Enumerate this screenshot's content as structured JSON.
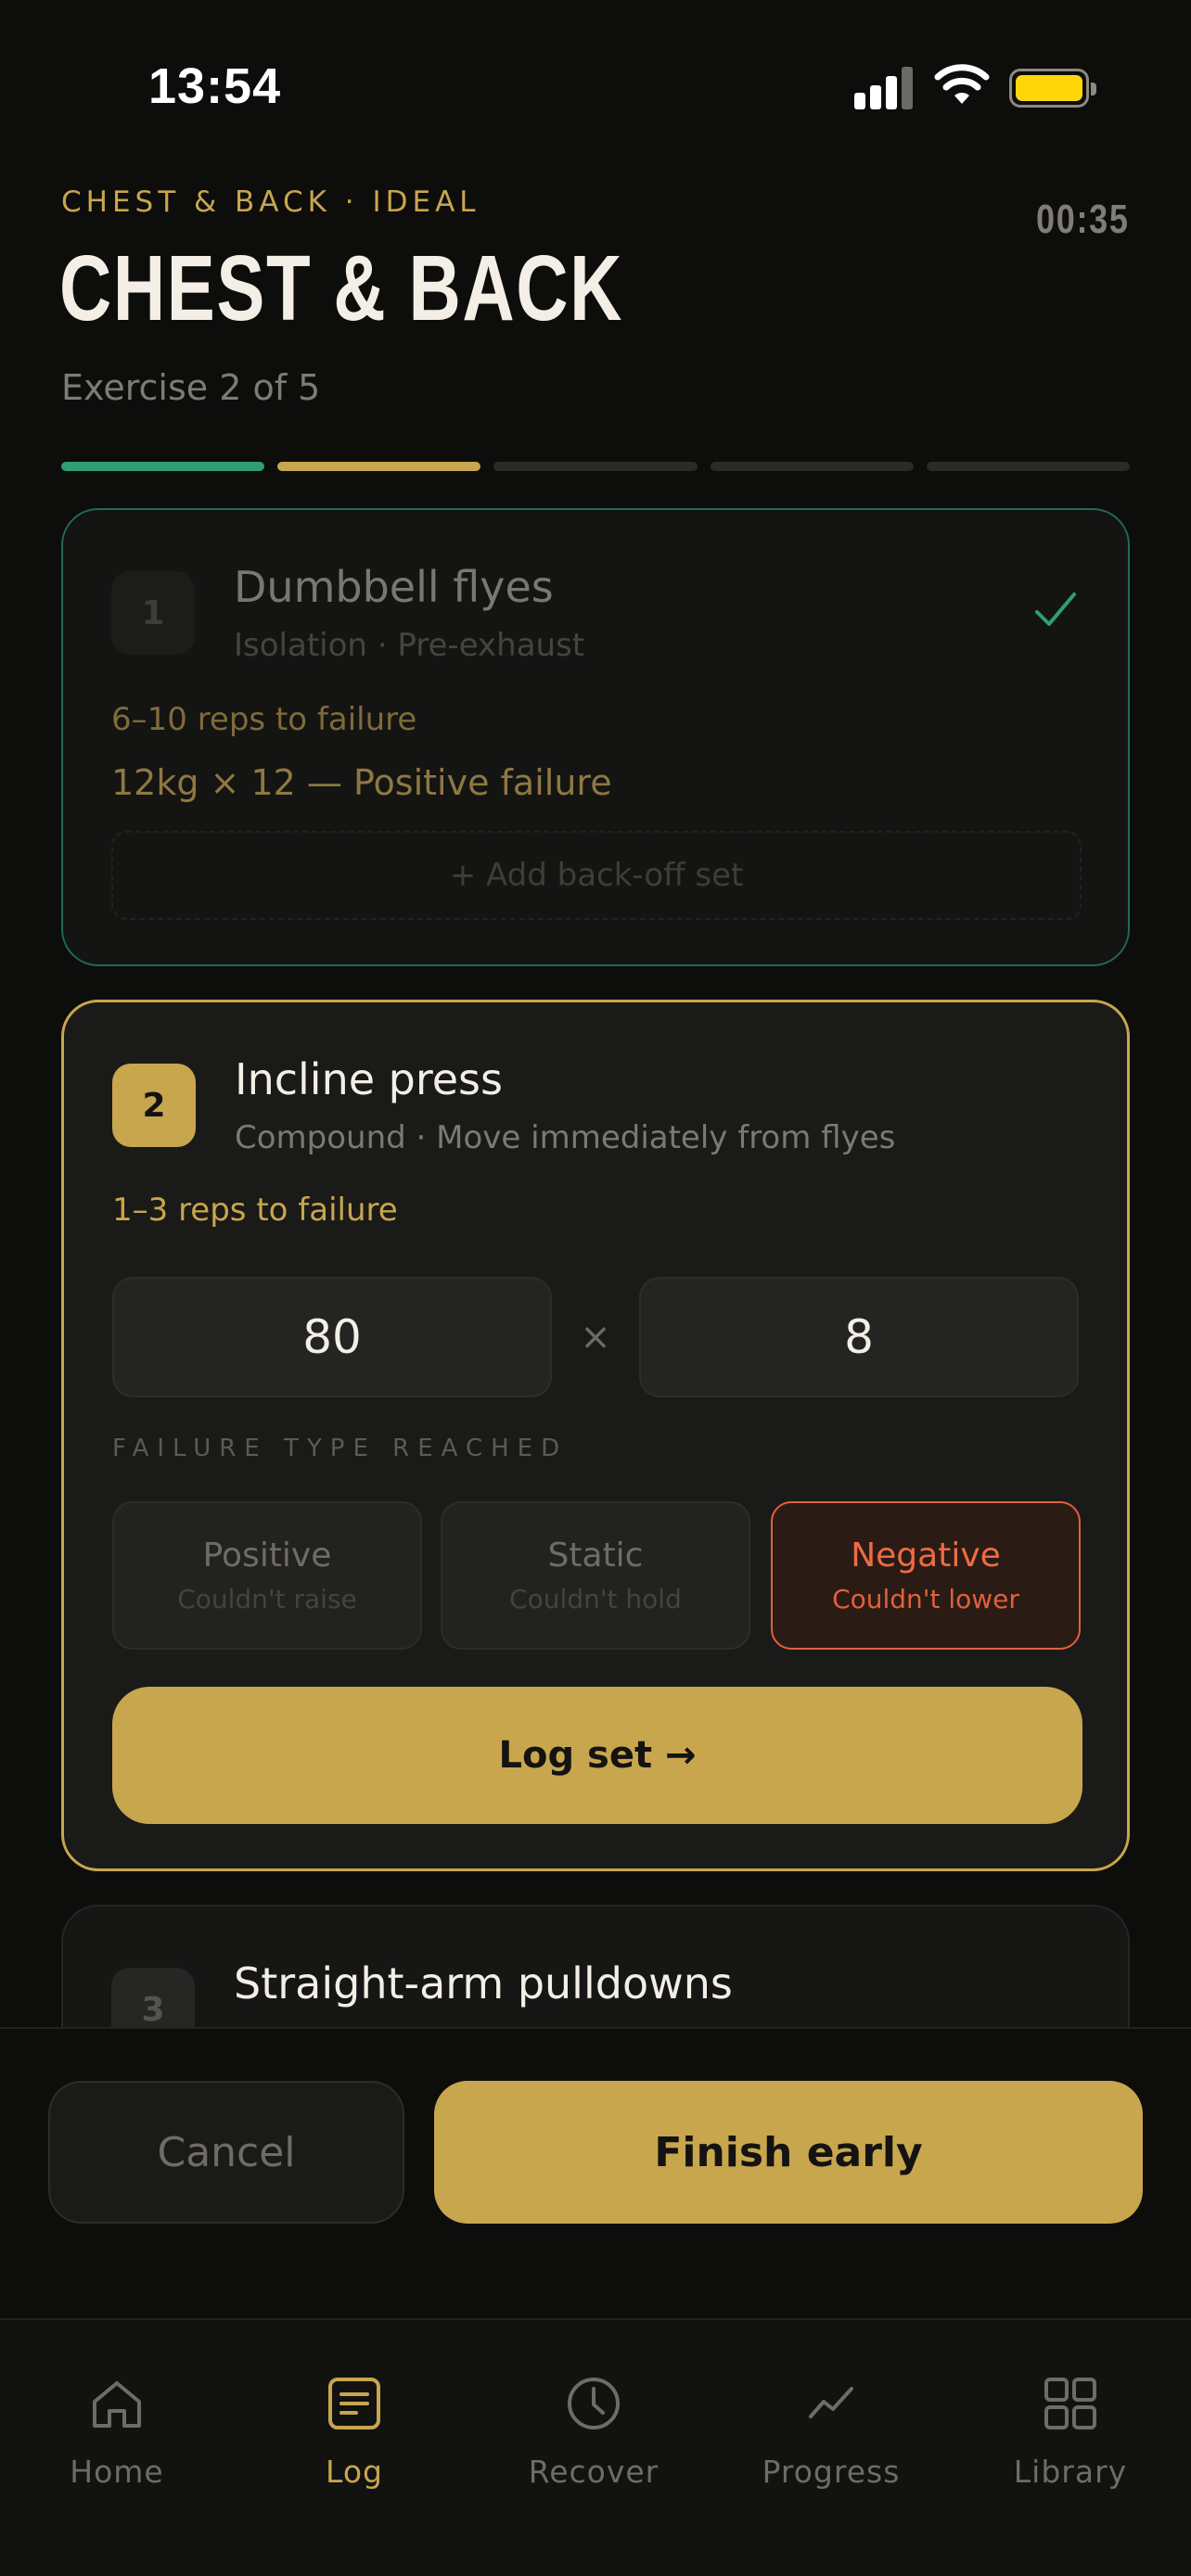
{
  "status_bar": {
    "time": "13:54",
    "battery_color": "#ffd60a"
  },
  "header": {
    "eyebrow": "CHEST & BACK · IDEAL",
    "timer": "00:35",
    "title": "CHEST & BACK",
    "subtitle": "Exercise 2 of 5",
    "progress": {
      "total_segments": 5,
      "completed": 1,
      "active": 2
    }
  },
  "exercises": [
    {
      "number": "1",
      "name": "Dumbbell flyes",
      "meta": "Isolation · Pre-exhaust",
      "target": "6–10 reps to failure",
      "logged_set": "12kg × 12 — Positive failure",
      "add_set_label": "+ Add back-off set",
      "status": "done",
      "check_icon": "check-icon"
    },
    {
      "number": "2",
      "name": "Incline press",
      "meta": "Compound · Move immediately from flyes",
      "target": "1–3 reps to failure",
      "weight_value": "80",
      "times_symbol": "×",
      "reps_value": "8",
      "failure_section_label": "FAILURE TYPE REACHED",
      "failure_types": [
        {
          "label": "Positive",
          "desc": "Couldn't raise",
          "selected": false
        },
        {
          "label": "Static",
          "desc": "Couldn't hold",
          "selected": false
        },
        {
          "label": "Negative",
          "desc": "Couldn't lower",
          "selected": true
        }
      ],
      "log_button": "Log set →",
      "status": "active"
    },
    {
      "number": "3",
      "name": "Straight-arm pulldowns",
      "status": "upcoming"
    }
  ],
  "actions": {
    "cancel": "Cancel",
    "finish": "Finish early"
  },
  "tabs": [
    {
      "label": "Home",
      "icon": "home-icon",
      "active": false
    },
    {
      "label": "Log",
      "icon": "clipboard-icon",
      "active": true
    },
    {
      "label": "Recover",
      "icon": "clock-icon",
      "active": false
    },
    {
      "label": "Progress",
      "icon": "trend-icon",
      "active": false
    },
    {
      "label": "Library",
      "icon": "grid-icon",
      "active": false
    }
  ],
  "colors": {
    "accent": "#c8a64e",
    "success": "#2f9e74",
    "danger": "#e0603c",
    "background": "#0d0d0c"
  }
}
